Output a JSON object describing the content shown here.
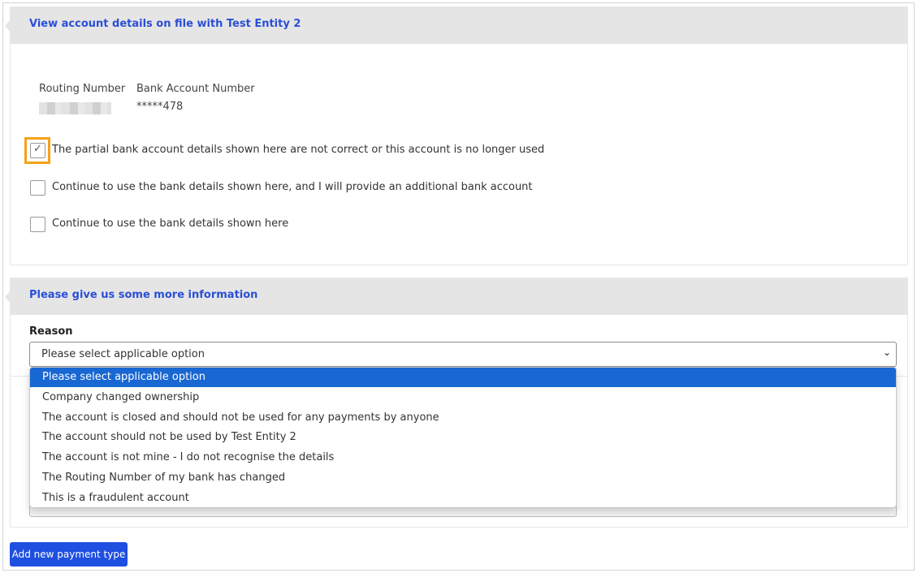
{
  "account_panel": {
    "title": "View account details on file with Test Entity 2",
    "routing_label": "Routing Number",
    "bank_account_label": "Bank Account Number",
    "bank_account_value": "*****478",
    "options": [
      {
        "label": "The partial bank account details shown here are not correct or this account is no longer used",
        "checked": true
      },
      {
        "label": "Continue to use the bank details shown here, and I will provide an additional bank account",
        "checked": false
      },
      {
        "label": "Continue to use the bank details shown here",
        "checked": false
      }
    ]
  },
  "info_panel": {
    "title": "Please give us some more information",
    "reason_label": "Reason",
    "reason_selected": "Please select applicable option"
  },
  "reason_dropdown": {
    "options": [
      "Please select applicable option",
      "Company changed ownership",
      "The account is closed and should not be used for any payments by anyone",
      "The account should not be used by Test Entity 2",
      "The account is not mine - I do not recognise the details",
      "The Routing Number of my bank has changed",
      "This is a fraudulent account"
    ],
    "selected_index": 0
  },
  "actions": {
    "add_payment_label": "Add new payment type"
  },
  "icons": {
    "check": "checkmark-icon",
    "chevron": "chevron-down-icon"
  },
  "colors": {
    "accent": "#1f4fe0",
    "title": "#2a4fd6",
    "highlight": "#f4a31b",
    "selected_option": "#1967d2"
  }
}
